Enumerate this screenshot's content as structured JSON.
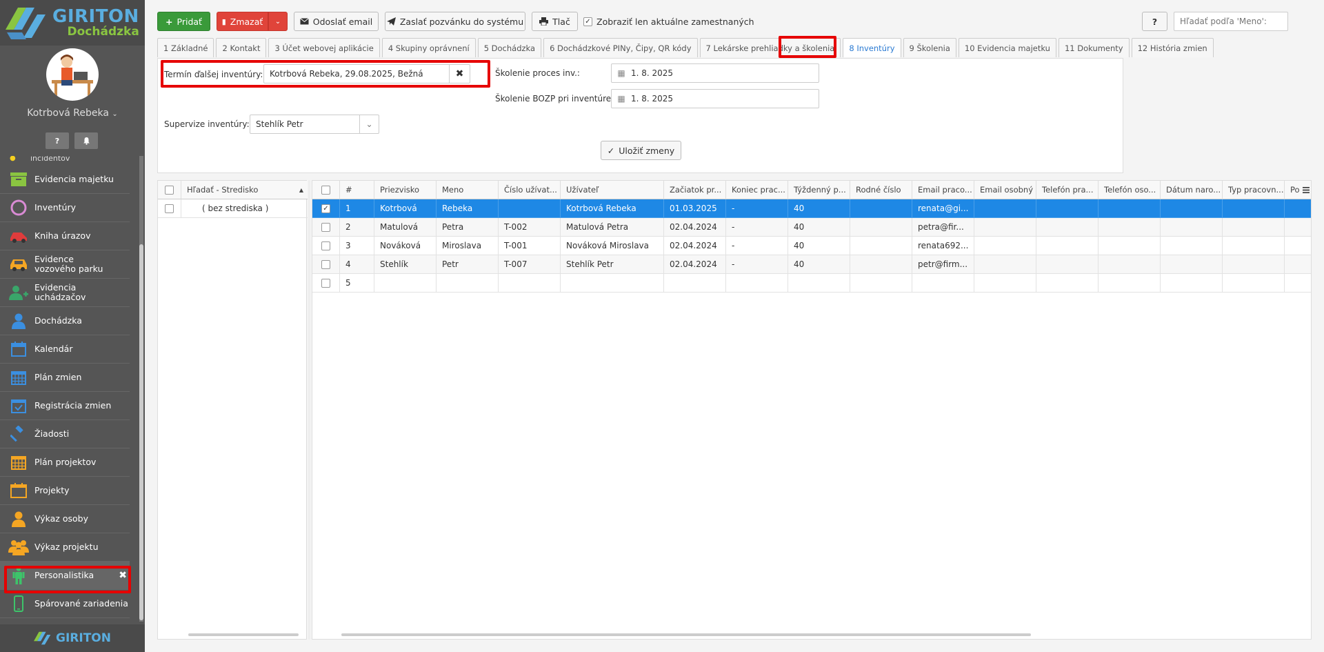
{
  "sidebar": {
    "logo": {
      "brand": "GIRITON",
      "product": "Dochádzka"
    },
    "user_name": "Kotrbová Rebeka",
    "partial_item": "incidentov",
    "items": [
      {
        "label": "Evidencia majetku",
        "icon": "inventory-box-icon",
        "color": "#8ac541"
      },
      {
        "label": "Inventúry",
        "icon": "circle-icon",
        "color": "#d98bd4"
      },
      {
        "label": "Kniha úrazov",
        "icon": "injury-car-icon",
        "color": "#e03c3c"
      },
      {
        "label": "Evidence vozového parku",
        "icon": "car-icon",
        "color": "#f5a623"
      },
      {
        "label": "Evidencia uchádzačov",
        "icon": "add-user-icon",
        "color": "#3aa66a"
      },
      {
        "label": "Dochádzka",
        "icon": "person-icon",
        "color": "#3b8fe0"
      },
      {
        "label": "Kalendár",
        "icon": "calendar-icon",
        "color": "#3b8fe0"
      },
      {
        "label": "Plán zmien",
        "icon": "calendar-grid-icon",
        "color": "#3b8fe0"
      },
      {
        "label": "Registrácia zmien",
        "icon": "calendar-check-icon",
        "color": "#3b8fe0"
      },
      {
        "label": "Žiadosti",
        "icon": "gavel-icon",
        "color": "#3b8fe0"
      },
      {
        "label": "Plán projektov",
        "icon": "calendar-grid-icon",
        "color": "#f5a623"
      },
      {
        "label": "Projekty",
        "icon": "folder-icon",
        "color": "#f5a623"
      },
      {
        "label": "Výkaz osoby",
        "icon": "person-icon",
        "color": "#f5a623"
      },
      {
        "label": "Výkaz projektu",
        "icon": "group-icon",
        "color": "#f5a623"
      },
      {
        "label": "Personalistika",
        "icon": "standing-person-icon",
        "color": "#3dc46a"
      },
      {
        "label": "Spárované zariadenia",
        "icon": "phone-icon",
        "color": "#3dc46a"
      }
    ],
    "footer_brand": "GIRITON"
  },
  "toolbar": {
    "add": "Pridať",
    "delete": "Zmazať",
    "send_email": "Odoslať email",
    "invite": "Zaslať pozvánku do systému",
    "print": "Tlač",
    "only_current": "Zobraziť len aktuálne zamestnaných",
    "help": "?",
    "search_placeholder": "Hľadať podľa 'Meno':"
  },
  "tabs": [
    "1 Základné",
    "2 Kontakt",
    "3 Účet webovej aplikácie",
    "4 Skupiny oprávnení",
    "5 Dochádzka",
    "6 Dochádzkové PINy, Čipy, QR kódy",
    "7 Lekárske prehliadky a školenia",
    "8 Inventúry",
    "9 Školenia",
    "10 Evidencia majetku",
    "11 Dokumenty",
    "12 História zmien"
  ],
  "form": {
    "next_inventory_label": "Termín ďalšej inventúry:",
    "next_inventory_value": "Kotrbová Rebeka, 29.08.2025, Bežná",
    "training_process_label": "Školenie proces inv.:",
    "training_process_value": "1. 8. 2025",
    "training_bozp_label": "Školenie BOZP pri inventúre:",
    "training_bozp_value": "1. 8. 2025",
    "supervision_label": "Supervize inventúry:",
    "supervision_value": "Stehlík Petr",
    "save": "Uložiť zmeny"
  },
  "left_grid": {
    "header": "Hľadať - Stredisko",
    "rows": [
      "( bez strediska )"
    ]
  },
  "main_grid": {
    "columns": [
      "#",
      "Priezvisko",
      "Meno",
      "Číslo užívat...",
      "Užívateľ",
      "Začiatok pr...",
      "Koniec prac...",
      "Týždenný p...",
      "Rodné číslo",
      "Email praco...",
      "Email osobný",
      "Telefón pra...",
      "Telefón oso...",
      "Dátum naro...",
      "Typ pracovn...",
      "Po"
    ],
    "rows": [
      {
        "num": "1",
        "surname": "Kotrbová",
        "name": "Rebeka",
        "user_no": "",
        "user": "Kotrbová Rebeka",
        "start": "01.03.2025",
        "end": "-",
        "weekly": "40",
        "birth": "",
        "email_work": "renata@gi..."
      },
      {
        "num": "2",
        "surname": "Matulová",
        "name": "Petra",
        "user_no": "T-002",
        "user": "Matulová Petra",
        "start": "02.04.2024",
        "end": "-",
        "weekly": "40",
        "birth": "",
        "email_work": "petra@fir..."
      },
      {
        "num": "3",
        "surname": "Nováková",
        "name": "Miroslava",
        "user_no": "T-001",
        "user": "Nováková Miroslava",
        "start": "02.04.2024",
        "end": "-",
        "weekly": "40",
        "birth": "",
        "email_work": "renata692..."
      },
      {
        "num": "4",
        "surname": "Stehlík",
        "name": "Petr",
        "user_no": "T-007",
        "user": "Stehlík Petr",
        "start": "02.04.2024",
        "end": "-",
        "weekly": "40",
        "birth": "",
        "email_work": "petr@firm..."
      },
      {
        "num": "5",
        "surname": "",
        "name": "",
        "user_no": "",
        "user": "",
        "start": "",
        "end": "",
        "weekly": "",
        "birth": "",
        "email_work": ""
      }
    ]
  },
  "colors": {
    "accent_blue": "#1e88e5",
    "highlight_red": "#e60000",
    "green": "#3a9a3a",
    "red": "#e0443a"
  }
}
